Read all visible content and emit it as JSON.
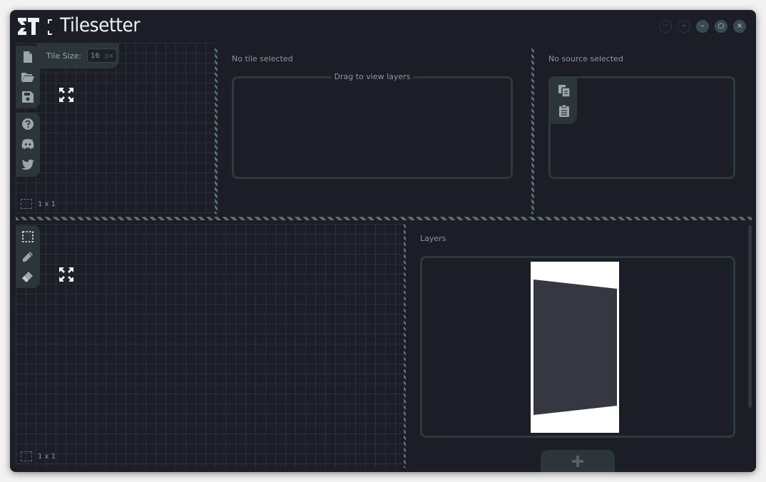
{
  "app": {
    "title": "Tilesetter"
  },
  "window_controls": [
    "−",
    "+",
    "–",
    "○",
    "×"
  ],
  "file_toolbar": {
    "icons": [
      "new-file-icon",
      "open-folder-icon",
      "save-icon"
    ]
  },
  "help_toolbar": {
    "icons": [
      "help-icon",
      "discord-icon",
      "twitter-icon"
    ]
  },
  "tile_size": {
    "label": "Tile Size:",
    "value": "16",
    "unit": "px"
  },
  "selection_top": {
    "label": "1 x 1"
  },
  "selection_bottom": {
    "label": "1 x 1"
  },
  "tools": {
    "icons": [
      "select-icon",
      "pencil-icon",
      "eraser-icon"
    ]
  },
  "tile_panel": {
    "status": "No tile selected",
    "legend": "Drag to view layers"
  },
  "source_panel": {
    "status": "No source selected",
    "icons": [
      "copy-icon",
      "paste-icon"
    ]
  },
  "layers_panel": {
    "label": "Layers"
  },
  "add_layer": {
    "label": "+"
  },
  "colors": {
    "background": "#1b1e26",
    "panel": "#2b353a",
    "border": "#2c3a3c",
    "text": "#8a989e"
  }
}
